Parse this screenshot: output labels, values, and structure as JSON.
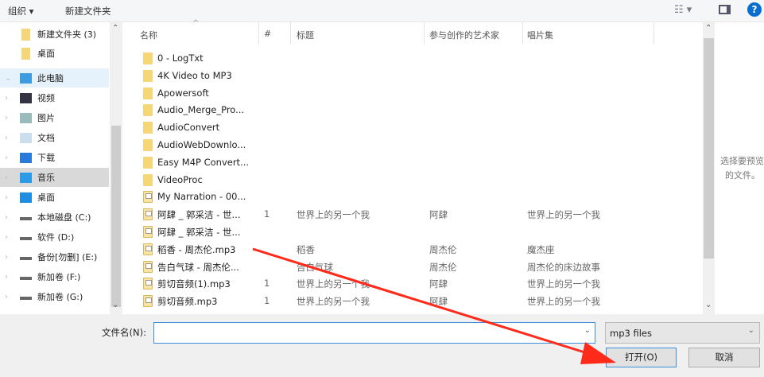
{
  "toolbar": {
    "organize": "组织 ▾",
    "new_folder": "新建文件夹"
  },
  "nav": [
    {
      "label": "新建文件夹 (3)",
      "icon": "folder-icon"
    },
    {
      "label": "桌面",
      "icon": "folder-icon"
    },
    {
      "label": "此电脑",
      "icon": "computer-icon"
    },
    {
      "label": "视频",
      "icon": "video-icon"
    },
    {
      "label": "图片",
      "icon": "picture-icon"
    },
    {
      "label": "文档",
      "icon": "document-icon"
    },
    {
      "label": "下载",
      "icon": "download-icon"
    },
    {
      "label": "音乐",
      "icon": "music-icon"
    },
    {
      "label": "桌面",
      "icon": "desktop-icon"
    },
    {
      "label": "本地磁盘 (C:)",
      "icon": "drive-icon"
    },
    {
      "label": "软件 (D:)",
      "icon": "drive-icon"
    },
    {
      "label": "备份[勿删] (E:)",
      "icon": "drive-icon"
    },
    {
      "label": "新加卷 (F:)",
      "icon": "drive-icon"
    },
    {
      "label": "新加卷 (G:)",
      "icon": "drive-icon"
    }
  ],
  "columns": {
    "name": "名称",
    "num": "#",
    "title": "标题",
    "artist": "参与创作的艺术家",
    "album": "唱片集"
  },
  "files": [
    {
      "name": "0 - LogTxt",
      "type": "folder",
      "num": "",
      "title": "",
      "artist": "",
      "album": ""
    },
    {
      "name": "4K Video to MP3",
      "type": "folder",
      "num": "",
      "title": "",
      "artist": "",
      "album": ""
    },
    {
      "name": "Apowersoft",
      "type": "folder",
      "num": "",
      "title": "",
      "artist": "",
      "album": ""
    },
    {
      "name": "Audio_Merge_Pro...",
      "type": "folder",
      "num": "",
      "title": "",
      "artist": "",
      "album": ""
    },
    {
      "name": "AudioConvert",
      "type": "folder",
      "num": "",
      "title": "",
      "artist": "",
      "album": ""
    },
    {
      "name": "AudioWebDownlo...",
      "type": "folder",
      "num": "",
      "title": "",
      "artist": "",
      "album": ""
    },
    {
      "name": "Easy M4P Convert...",
      "type": "folder",
      "num": "",
      "title": "",
      "artist": "",
      "album": ""
    },
    {
      "name": "VideoProc",
      "type": "folder",
      "num": "",
      "title": "",
      "artist": "",
      "album": ""
    },
    {
      "name": "My Narration - 00...",
      "type": "file",
      "num": "",
      "title": "",
      "artist": "",
      "album": ""
    },
    {
      "name": "阿肆 _ 郭采洁 - 世...",
      "type": "file",
      "num": "1",
      "title": "世界上的另一个我",
      "artist": "阿肆",
      "album": "世界上的另一个我"
    },
    {
      "name": "阿肆 _ 郭采洁 - 世...",
      "type": "file",
      "num": "",
      "title": "",
      "artist": "",
      "album": ""
    },
    {
      "name": "稻香 - 周杰伦.mp3",
      "type": "file",
      "num": "",
      "title": "稻香",
      "artist": "周杰伦",
      "album": "魔杰座"
    },
    {
      "name": "告白气球 - 周杰伦...",
      "type": "file",
      "num": "",
      "title": "告白气球",
      "artist": "周杰伦",
      "album": "周杰伦的床边故事"
    },
    {
      "name": "剪切音频(1).mp3",
      "type": "file",
      "num": "1",
      "title": "世界上的另一个我",
      "artist": "阿肆",
      "album": "世界上的另一个我"
    },
    {
      "name": "剪切音频.mp3",
      "type": "file",
      "num": "1",
      "title": "世界上的另一个我",
      "artist": "阿肆",
      "album": "世界上的另一个我"
    }
  ],
  "preview": {
    "line1": "选择要预览",
    "line2": "的文件。"
  },
  "bottom": {
    "filename_label": "文件名(N):",
    "filename_value": "",
    "filter": "mp3 files",
    "open": "打开(O)",
    "cancel": "取消"
  },
  "colors": {
    "arrow": "#ff2a1a",
    "accent": "#0078d7"
  }
}
